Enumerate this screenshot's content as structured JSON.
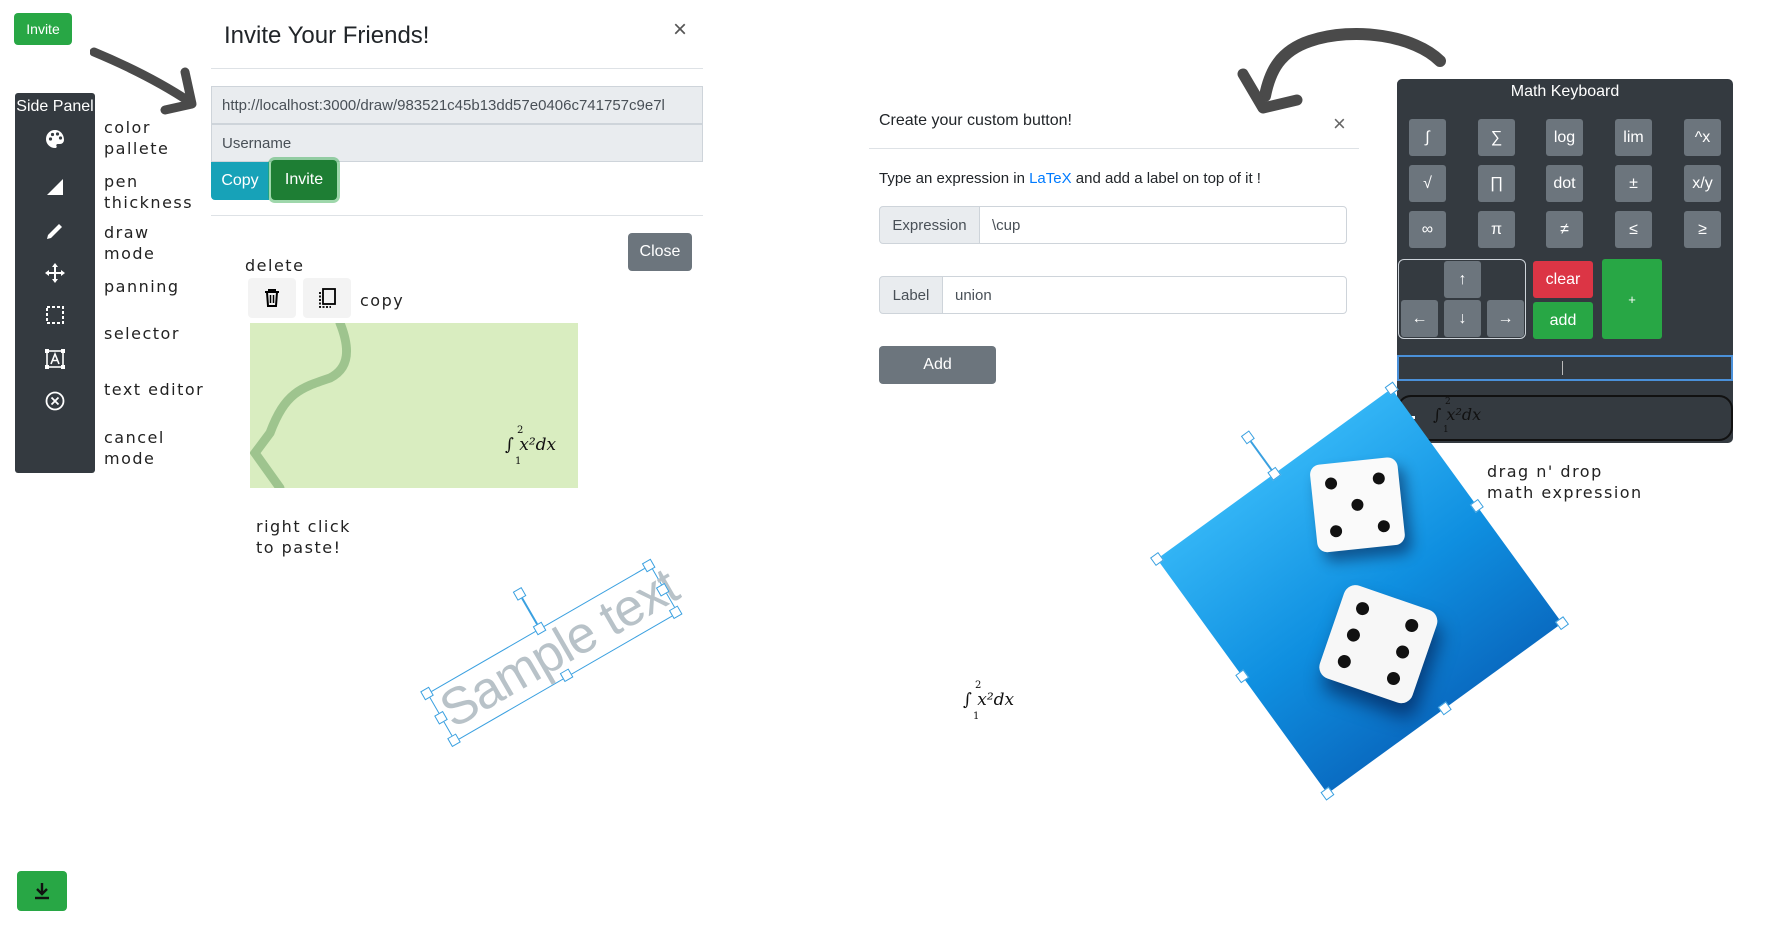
{
  "top_invite_button": "Invite",
  "side_panel": {
    "title": "Side Panel",
    "items": [
      {
        "icon": "palette-icon",
        "label": "color\npallete"
      },
      {
        "icon": "pen-thickness-icon",
        "label": "pen\nthickness"
      },
      {
        "icon": "pencil-icon",
        "label": "draw\nmode"
      },
      {
        "icon": "move-arrows-icon",
        "label": "panning"
      },
      {
        "icon": "selection-icon",
        "label": "selector"
      },
      {
        "icon": "text-editor-icon",
        "label": "text editor"
      },
      {
        "icon": "cancel-circle-icon",
        "label": "cancel\nmode"
      }
    ]
  },
  "invite_modal": {
    "title": "Invite Your Friends!",
    "close_symbol": "×",
    "url": "http://localhost:3000/draw/983521c45b13dd57e0406c741757c9e7l",
    "username_placeholder": "Username",
    "copy_label": "Copy",
    "invite_label": "Invite",
    "close_label": "Close"
  },
  "clipboard_demo": {
    "delete_label": "delete",
    "copy_label": "copy",
    "paste_hint": "right click\nto paste!"
  },
  "math_expression_text": "∫ x²dx",
  "math_lower_limit": "1",
  "math_upper_limit": "2",
  "sample_text": "Sample text",
  "custom_button_modal": {
    "title": "Create your custom button!",
    "close_symbol": "×",
    "description_before": "Type an expression in ",
    "description_link": "LaTeX",
    "description_after": " and add a label on top of it !",
    "expression_label": "Expression",
    "expression_value": "\\cup",
    "label_label": "Label",
    "label_value": "union",
    "add_label": "Add"
  },
  "math_keyboard": {
    "title": "Math Keyboard",
    "keys_row1": [
      "∫",
      "∑",
      "log",
      "lim",
      "^x"
    ],
    "keys_row2": [
      "√",
      "∏",
      "dot",
      "±",
      "x/y"
    ],
    "keys_row3": [
      "∞",
      "π",
      "≠",
      "≤",
      "≥"
    ],
    "arrow_up": "↑",
    "arrow_left": "←",
    "arrow_down": "↓",
    "arrow_right": "→",
    "clear_label": "clear",
    "add_label": "add",
    "plus_label": "+",
    "expression_preview": "∫ x²dx",
    "drag_hint": "drag n' drop\nmath expression"
  },
  "colors": {
    "green": "#28a745",
    "dark_green": "#1e7e34",
    "teal": "#17a2b8",
    "gray": "#6c757d",
    "dark_panel": "#343a40",
    "red": "#dc3545",
    "light_green_canvas": "#d9edc0",
    "selection_blue": "#3aa0e0"
  }
}
